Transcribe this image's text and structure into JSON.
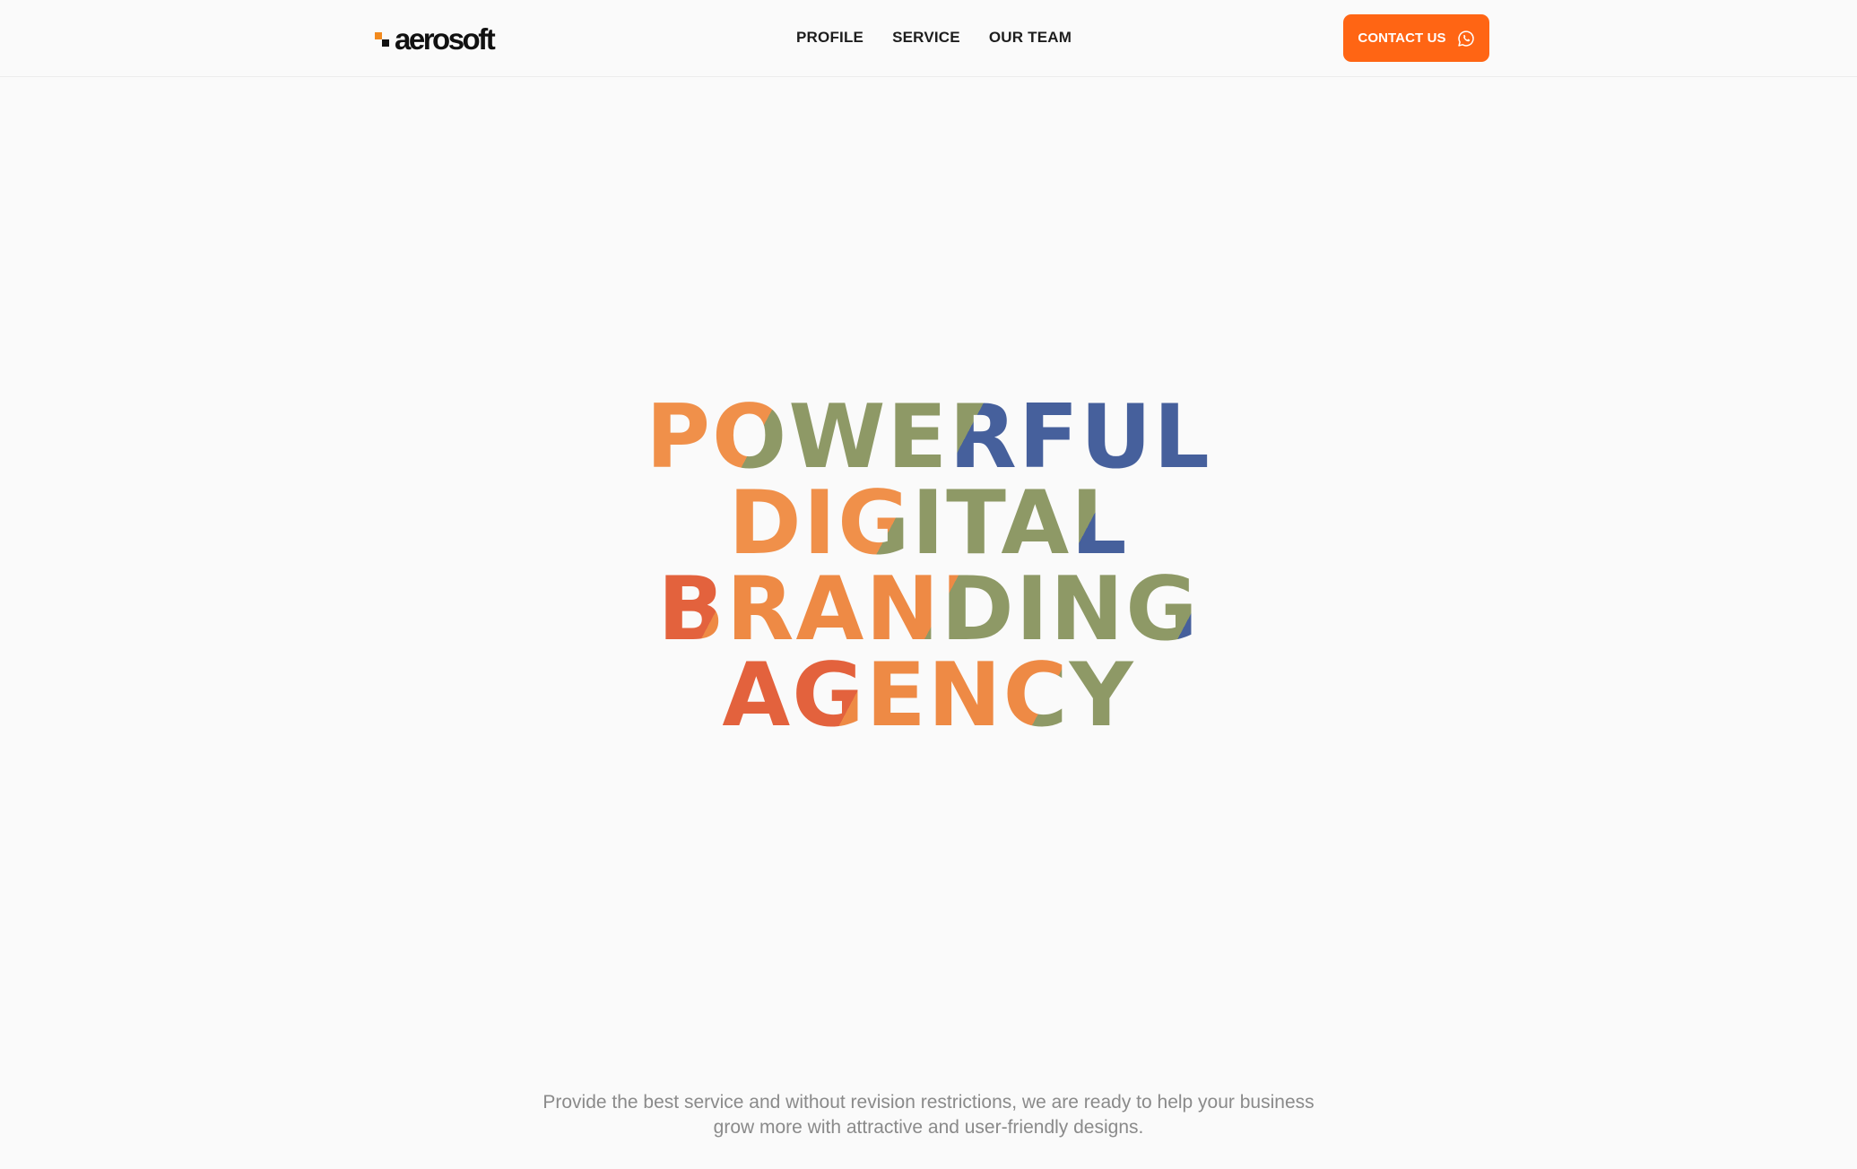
{
  "brand": {
    "logo_text": "aerosoft",
    "accent_color": "#ff6514"
  },
  "nav": {
    "items": [
      {
        "label": "PROFILE"
      },
      {
        "label": "SERVICE"
      },
      {
        "label": "OUR TEAM"
      }
    ]
  },
  "contact_button": {
    "label": "CONTACT US",
    "icon": "whatsapp-icon"
  },
  "hero": {
    "lines": [
      "POWERFUL",
      "DIGITAL",
      "BRANDING",
      "AGENCY"
    ],
    "colors": [
      "#f0904a",
      "#8e9966",
      "#46609c",
      "#e3623d"
    ]
  },
  "tagline": {
    "line1": "Provide the best service and without revision restrictions, we are ready to help your business",
    "line2": "grow more with attractive and user-friendly designs."
  }
}
